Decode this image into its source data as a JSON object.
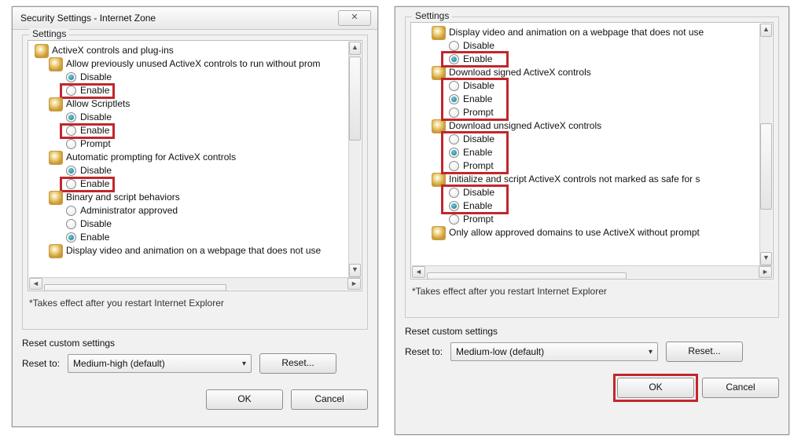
{
  "left": {
    "title": "Security Settings - Internet Zone",
    "close_glyph": "✕",
    "group_label": "Settings",
    "tree": [
      {
        "kind": "cat",
        "indent": 0,
        "text": "ActiveX controls and plug-ins"
      },
      {
        "kind": "item",
        "indent": 1,
        "text": "Allow previously unused ActiveX controls to run without prom"
      },
      {
        "kind": "radio",
        "indent": 2,
        "text": "Disable",
        "selected": true,
        "hl": false
      },
      {
        "kind": "radio",
        "indent": 2,
        "text": "Enable",
        "selected": false,
        "hl": true
      },
      {
        "kind": "item",
        "indent": 1,
        "text": "Allow Scriptlets"
      },
      {
        "kind": "radio",
        "indent": 2,
        "text": "Disable",
        "selected": true,
        "hl": false
      },
      {
        "kind": "radio",
        "indent": 2,
        "text": "Enable",
        "selected": false,
        "hl": true
      },
      {
        "kind": "radio",
        "indent": 2,
        "text": "Prompt",
        "selected": false,
        "hl": false
      },
      {
        "kind": "item",
        "indent": 1,
        "text": "Automatic prompting for ActiveX controls"
      },
      {
        "kind": "radio",
        "indent": 2,
        "text": "Disable",
        "selected": true,
        "hl": false
      },
      {
        "kind": "radio",
        "indent": 2,
        "text": "Enable",
        "selected": false,
        "hl": true
      },
      {
        "kind": "item",
        "indent": 1,
        "text": "Binary and script behaviors"
      },
      {
        "kind": "radio",
        "indent": 2,
        "text": "Administrator approved",
        "selected": false,
        "hl": false
      },
      {
        "kind": "radio",
        "indent": 2,
        "text": "Disable",
        "selected": false,
        "hl": false
      },
      {
        "kind": "radio",
        "indent": 2,
        "text": "Enable",
        "selected": true,
        "hl": false
      },
      {
        "kind": "item",
        "indent": 1,
        "text": "Display video and animation on a webpage that does not use"
      }
    ],
    "note": "*Takes effect after you restart Internet Explorer",
    "reset_section_label": "Reset custom settings",
    "reset_to_label": "Reset to:",
    "reset_value": "Medium-high (default)",
    "reset_btn": "Reset...",
    "ok_label": "OK",
    "cancel_label": "Cancel"
  },
  "right": {
    "group_label": "Settings",
    "tree": [
      {
        "kind": "item",
        "indent": 1,
        "text": "Display video and animation on a webpage that does not use"
      },
      {
        "kind": "radio",
        "indent": 2,
        "text": "Disable",
        "selected": false,
        "hl": false
      },
      {
        "kind": "radio",
        "indent": 2,
        "text": "Enable",
        "selected": true,
        "hl": true
      },
      {
        "kind": "item",
        "indent": 1,
        "text": "Download signed ActiveX controls"
      },
      {
        "kind": "radio",
        "indent": 2,
        "text": "Disable",
        "selected": false,
        "hl": true
      },
      {
        "kind": "radio",
        "indent": 2,
        "text": "Enable",
        "selected": true,
        "hl": true
      },
      {
        "kind": "radio",
        "indent": 2,
        "text": "Prompt",
        "selected": false,
        "hl": true
      },
      {
        "kind": "item",
        "indent": 1,
        "text": "Download unsigned ActiveX controls"
      },
      {
        "kind": "radio",
        "indent": 2,
        "text": "Disable",
        "selected": false,
        "hl": true
      },
      {
        "kind": "radio",
        "indent": 2,
        "text": "Enable",
        "selected": true,
        "hl": true
      },
      {
        "kind": "radio",
        "indent": 2,
        "text": "Prompt",
        "selected": false,
        "hl": true
      },
      {
        "kind": "item",
        "indent": 1,
        "text": "Initialize and script ActiveX controls not marked as safe for s"
      },
      {
        "kind": "radio",
        "indent": 2,
        "text": "Disable",
        "selected": false,
        "hl": true
      },
      {
        "kind": "radio",
        "indent": 2,
        "text": "Enable",
        "selected": true,
        "hl": true
      },
      {
        "kind": "radio",
        "indent": 2,
        "text": "Prompt",
        "selected": false,
        "hl": false
      },
      {
        "kind": "item",
        "indent": 1,
        "text": "Only allow approved domains to use ActiveX without prompt"
      }
    ],
    "note": "*Takes effect after you restart Internet Explorer",
    "reset_section_label": "Reset custom settings",
    "reset_to_label": "Reset to:",
    "reset_value": "Medium-low (default)",
    "reset_btn": "Reset...",
    "ok_label": "OK",
    "cancel_label": "Cancel",
    "highlight_ok": true
  }
}
